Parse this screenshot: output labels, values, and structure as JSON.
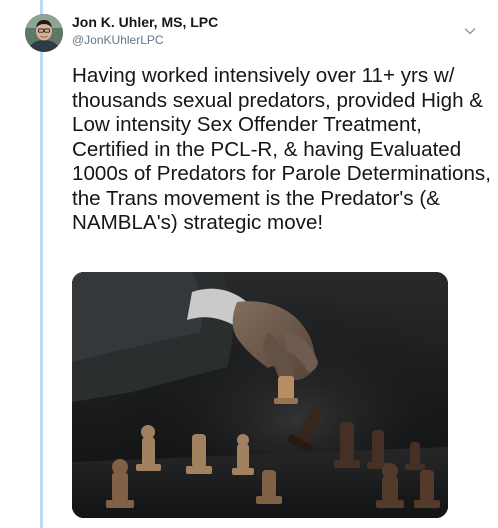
{
  "tweet": {
    "author_name": "Jon K. Uhler, MS, LPC",
    "author_handle": "@JonKUhlerLPC",
    "text": "Having worked intensively over 11+ yrs w/ thousands sexual predators, provided High & Low intensity Sex Offender Treatment, Certified in the PCL-R, & having Evaluated 1000s of Predators for Parole Determinations, the Trans movement is the Predator's (& NAMBLA's) strategic move!",
    "menu_icon": "chevron-down-icon",
    "media_description_icon": "chess-photo"
  },
  "colors": {
    "thread_line": "#b8dcf3",
    "text": "#14171a",
    "secondary_text": "#657786"
  }
}
